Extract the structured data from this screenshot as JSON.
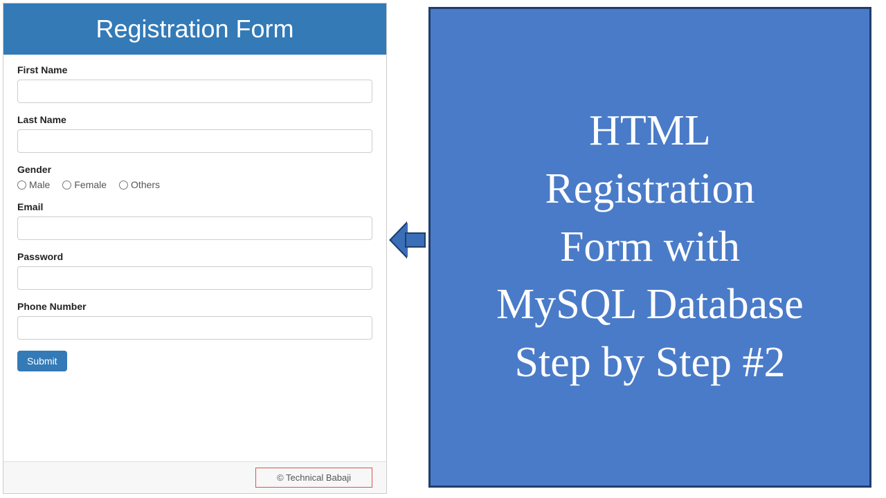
{
  "form": {
    "title": "Registration Form",
    "firstNameLabel": "First Name",
    "lastNameLabel": "Last Name",
    "genderLabel": "Gender",
    "genderOptions": {
      "male": "Male",
      "female": "Female",
      "others": "Others"
    },
    "emailLabel": "Email",
    "passwordLabel": "Password",
    "phoneLabel": "Phone Number",
    "submitLabel": "Submit",
    "copyright": "© Technical Babaji"
  },
  "slide": {
    "text": "HTML\nRegistration\nForm with\nMySQL Database\nStep by Step #2"
  }
}
